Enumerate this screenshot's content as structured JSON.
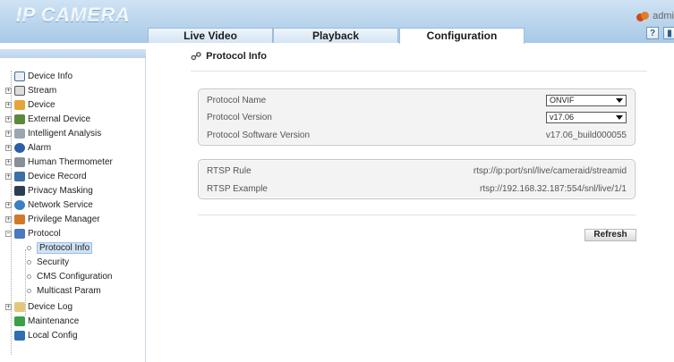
{
  "header": {
    "logo": "IP CAMERA",
    "user": "admi",
    "tabs": [
      {
        "label": "Live Video"
      },
      {
        "label": "Playback"
      },
      {
        "label": "Configuration"
      }
    ]
  },
  "nav": {
    "items": [
      {
        "label": "Device Info",
        "expandable": false
      },
      {
        "label": "Stream",
        "expandable": true
      },
      {
        "label": "Device",
        "expandable": true
      },
      {
        "label": "External Device",
        "expandable": true
      },
      {
        "label": "Intelligent Analysis",
        "expandable": true
      },
      {
        "label": "Alarm",
        "expandable": true
      },
      {
        "label": "Human Thermometer",
        "expandable": true
      },
      {
        "label": "Device Record",
        "expandable": true
      },
      {
        "label": "Privacy Masking",
        "expandable": false
      },
      {
        "label": "Network Service",
        "expandable": true
      },
      {
        "label": "Privilege Manager",
        "expandable": true
      },
      {
        "label": "Protocol",
        "expandable": true,
        "expanded": true
      },
      {
        "label": "Protocol Info",
        "child": true,
        "selected": true
      },
      {
        "label": "Security",
        "child": true
      },
      {
        "label": "CMS Configuration",
        "child": true
      },
      {
        "label": "Multicast Param",
        "child": true
      },
      {
        "label": "Device Log",
        "expandable": true
      },
      {
        "label": "Maintenance",
        "expandable": false
      },
      {
        "label": "Local Config",
        "expandable": false
      }
    ]
  },
  "main": {
    "title": "Protocol Info",
    "protocol_group": {
      "name_label": "Protocol Name",
      "name_value": "ONVIF",
      "version_label": "Protocol Version",
      "version_value": "v17.06",
      "software_label": "Protocol Software Version",
      "software_value": "v17.06_build000055"
    },
    "rtsp_group": {
      "rule_label": "RTSP Rule",
      "rule_value": "rtsp://ip:port/snl/live/cameraid/streamid",
      "example_label": "RTSP Example",
      "example_value": "rtsp://192.168.32.187:554/snl/live/1/1"
    },
    "refresh_label": "Refresh"
  },
  "colors": {
    "header_top": "#cfe3f4",
    "header_bottom": "#a9c9e6",
    "selected_bg": "#cfe3f6"
  }
}
